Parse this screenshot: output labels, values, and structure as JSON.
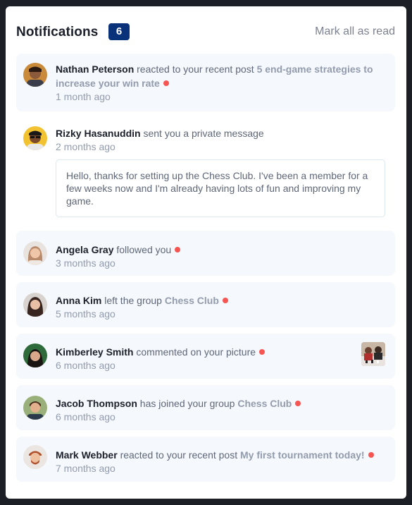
{
  "header": {
    "title": "Notifications",
    "unread_count": "6",
    "mark_all_label": "Mark all as read"
  },
  "colors": {
    "badge": "#0a327b",
    "unread_dot": "#f65552",
    "unread_bg": "#f5f8fc"
  },
  "notifications": [
    {
      "name": "Nathan Peterson",
      "action": "reacted to your recent post",
      "target": "5 end-game strategies to increase your win rate",
      "time": "1 month ago",
      "unread": true
    },
    {
      "name": "Rizky Hasanuddin",
      "action": "sent you a private message",
      "time": "2 months ago",
      "unread": false,
      "message": "Hello, thanks for setting up the Chess Club. I've been a member for a few weeks now and I'm already having lots of fun and improving my game."
    },
    {
      "name": "Angela Gray",
      "action": "followed you",
      "time": "3 months ago",
      "unread": true
    },
    {
      "name": "Anna Kim",
      "action": "left the group",
      "target": "Chess Club",
      "time": "5 months ago",
      "unread": true
    },
    {
      "name": "Kimberley Smith",
      "action": "commented on your picture",
      "time": "6 months ago",
      "unread": true
    },
    {
      "name": "Jacob Thompson",
      "action": "has joined your group",
      "target": "Chess Club",
      "time": "6 months ago",
      "unread": true
    },
    {
      "name": "Mark Webber",
      "action": "reacted to your recent post",
      "target": "My first tournament today!",
      "time": "7 months ago",
      "unread": true
    }
  ]
}
